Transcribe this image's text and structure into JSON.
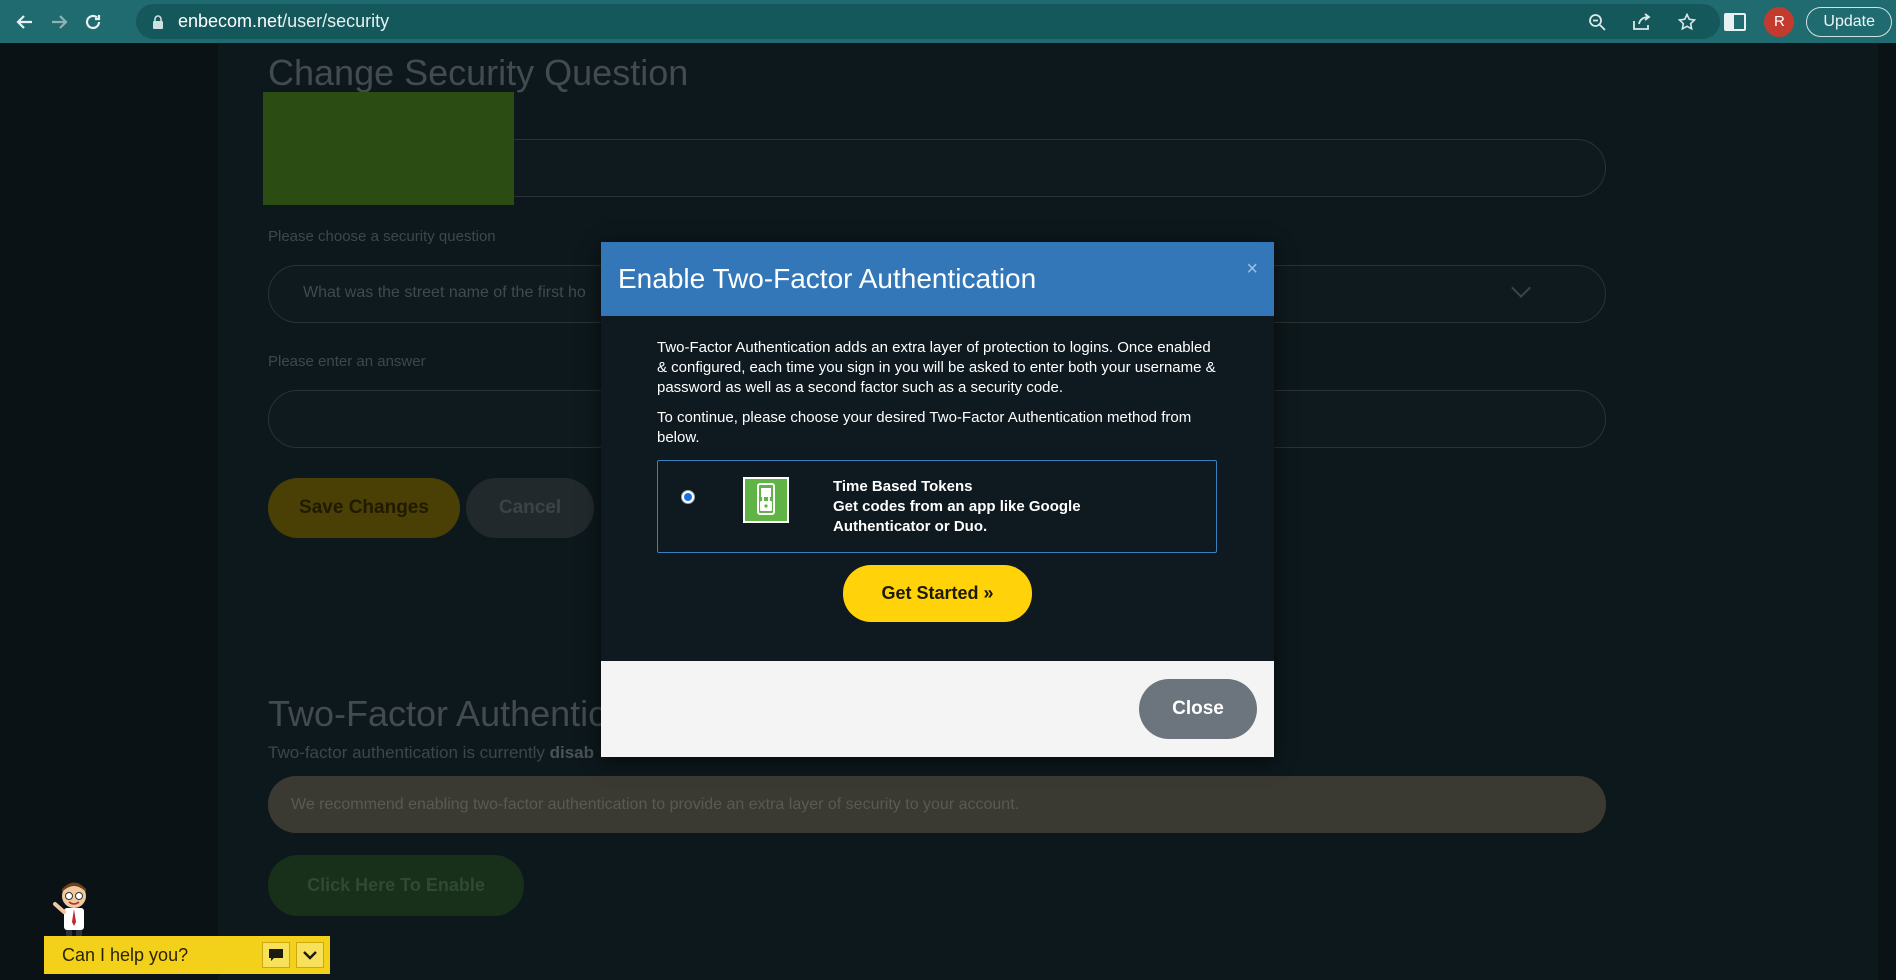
{
  "browser": {
    "url_domain": "enbecom.net",
    "url_path": "/user/security",
    "profile_initial": "R",
    "update_label": "Update"
  },
  "page": {
    "security_heading": "Change Security Question",
    "question_label": "Please choose a security question",
    "question_value": "What was the street name of the first ho",
    "answer_label": "Please enter an answer",
    "save_label": "Save Changes",
    "cancel_label": "Cancel",
    "tfa_heading": "Two-Factor Authentic",
    "tfa_status_prefix": "Two-factor authentication is currently",
    "tfa_status_value": "disab",
    "recommend_text": "We recommend enabling two-factor authentication to provide an extra layer of security to your account.",
    "enable_label": "Click Here To Enable"
  },
  "chat": {
    "label": "Can I help you?"
  },
  "modal": {
    "title": "Enable Two-Factor Authentication",
    "close_x": "×",
    "intro": "Two-Factor Authentication adds an extra layer of protection to logins. Once enabled & configured, each time you sign in you will be asked to enter both your username & password as well as a second factor such as a security code.",
    "continue": "To continue, please choose your desired Two-Factor Authentication method from below.",
    "option_title": "Time Based Tokens",
    "option_desc": "Get codes from an app like Google Authenticator or Duo.",
    "get_started_label": "Get Started »",
    "close_label": "Close"
  }
}
